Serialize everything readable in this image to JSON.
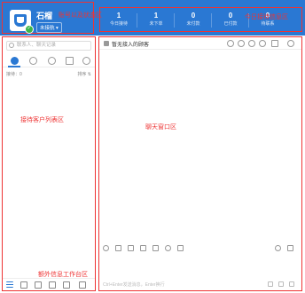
{
  "account": {
    "name": "石榴",
    "status": "未接航 ▾",
    "zone_label": "账号以及状态区"
  },
  "stats": {
    "zone_label": "今日接待信息区",
    "items": [
      {
        "num": "1",
        "label": "今日接待"
      },
      {
        "num": "1",
        "label": "未下单"
      },
      {
        "num": "0",
        "label": "未付款"
      },
      {
        "num": "0",
        "label": "已付款"
      },
      {
        "num": "0",
        "label": "待联系"
      }
    ]
  },
  "left_panel": {
    "search_placeholder": "联系人、聊天记录",
    "sort_left": "接待：0",
    "sort_right": "排序 ⇅",
    "zone_label": "接待客户列表区",
    "bottom_label": "额外信息工作台区"
  },
  "chat": {
    "contact_name": "暂无接入的顾客",
    "zone_label": "聊天窗口区",
    "input_hint": "Ctrl+Enter发送消息，Enter换行"
  }
}
